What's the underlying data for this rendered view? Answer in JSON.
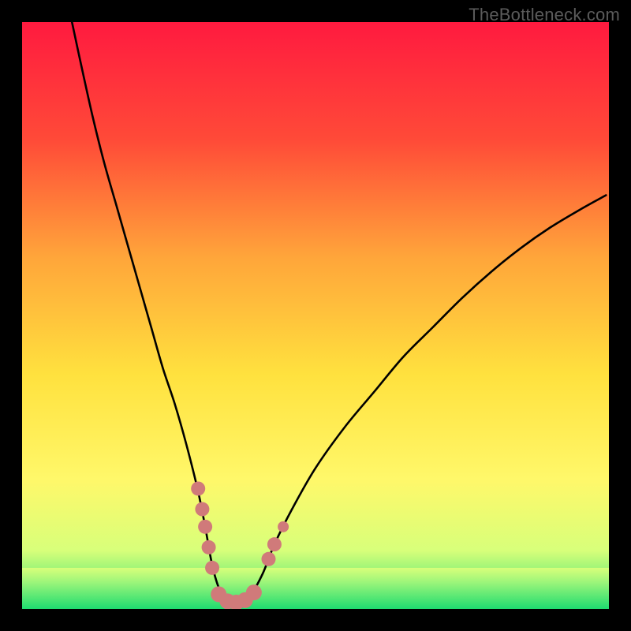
{
  "watermark": "TheBottleneck.com",
  "chart_data": {
    "type": "line",
    "title": "",
    "xlabel": "",
    "ylabel": "",
    "xlim": [
      0,
      100
    ],
    "ylim": [
      0,
      100
    ],
    "background_gradient": {
      "stops": [
        {
          "offset": 0.0,
          "color": "#ff1a3f"
        },
        {
          "offset": 0.2,
          "color": "#ff4a38"
        },
        {
          "offset": 0.4,
          "color": "#ffa53a"
        },
        {
          "offset": 0.6,
          "color": "#ffe13e"
        },
        {
          "offset": 0.78,
          "color": "#fff86a"
        },
        {
          "offset": 0.9,
          "color": "#d8ff7a"
        },
        {
          "offset": 1.0,
          "color": "#22e073"
        }
      ]
    },
    "green_band_y_range": [
      0,
      7
    ],
    "series": [
      {
        "name": "curve",
        "color": "#000000",
        "stroke_width": 2.6,
        "x": [
          8.5,
          10,
          12,
          14,
          16,
          18,
          20,
          22,
          24,
          26,
          28,
          30,
          31.2,
          32.5,
          34,
          35.5,
          37,
          39,
          41,
          43,
          46,
          50,
          55,
          60,
          65,
          70,
          75,
          80,
          85,
          90,
          95,
          99.5
        ],
        "y": [
          100,
          93,
          84,
          76,
          69,
          62,
          55,
          48,
          41,
          35,
          28,
          20,
          14,
          7,
          2.5,
          1.2,
          1.2,
          2.5,
          6,
          11,
          17,
          24,
          31,
          37,
          43,
          48,
          53,
          57.5,
          61.5,
          65,
          68,
          70.5
        ]
      }
    ],
    "marker_clusters": [
      {
        "name": "left-cluster",
        "color": "#d07a7a",
        "points": [
          {
            "x": 30.0,
            "y": 20.5,
            "r": 9
          },
          {
            "x": 30.7,
            "y": 17.0,
            "r": 9
          },
          {
            "x": 31.2,
            "y": 14.0,
            "r": 9
          },
          {
            "x": 31.8,
            "y": 10.5,
            "r": 9
          },
          {
            "x": 32.4,
            "y": 7.0,
            "r": 9
          }
        ]
      },
      {
        "name": "bottom-cluster",
        "color": "#d07a7a",
        "points": [
          {
            "x": 33.5,
            "y": 2.5,
            "r": 10
          },
          {
            "x": 35.0,
            "y": 1.3,
            "r": 10
          },
          {
            "x": 36.5,
            "y": 1.1,
            "r": 10
          },
          {
            "x": 38.0,
            "y": 1.5,
            "r": 10
          },
          {
            "x": 39.5,
            "y": 2.8,
            "r": 10
          }
        ]
      },
      {
        "name": "right-cluster",
        "color": "#d07a7a",
        "points": [
          {
            "x": 42.0,
            "y": 8.5,
            "r": 9
          },
          {
            "x": 43.0,
            "y": 11.0,
            "r": 9
          },
          {
            "x": 44.5,
            "y": 14.0,
            "r": 7
          }
        ]
      }
    ]
  }
}
